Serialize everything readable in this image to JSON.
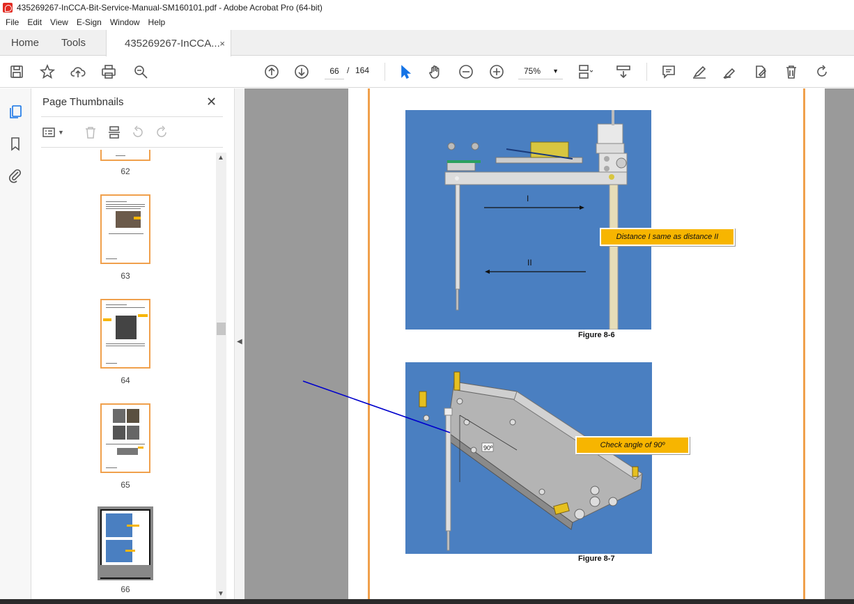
{
  "window": {
    "title": "435269267-InCCA-Bit-Service-Manual-SM160101.pdf - Adobe Acrobat Pro (64-bit)"
  },
  "menu": [
    "File",
    "Edit",
    "View",
    "E-Sign",
    "Window",
    "Help"
  ],
  "tabs": {
    "home": "Home",
    "tools": "Tools",
    "document": "435269267-InCCA...",
    "close_glyph": "×"
  },
  "toolbar": {
    "current_page": "66",
    "page_separator": "/",
    "total_pages": "164",
    "zoom": "75%"
  },
  "sidebar": {
    "title": "Page Thumbnails",
    "close_glyph": "✕",
    "thumbnails": [
      {
        "label": "62"
      },
      {
        "label": "63"
      },
      {
        "label": "64"
      },
      {
        "label": "65"
      },
      {
        "label": "66",
        "selected": true
      }
    ]
  },
  "document": {
    "figure1": {
      "marker_top": "I",
      "marker_bottom": "II",
      "callout": "Distance I same as distance II",
      "caption": "Figure 8-6"
    },
    "figure2": {
      "angle_label": "90º",
      "callout": "Check angle of 90º",
      "caption": "Figure 8-7"
    }
  },
  "colors": {
    "accent": "#1473e6",
    "page_border": "#f0a04c",
    "figure_bg": "#4a7fc1",
    "callout_bg": "#f7b500",
    "annotation_line": "#0000cc"
  }
}
